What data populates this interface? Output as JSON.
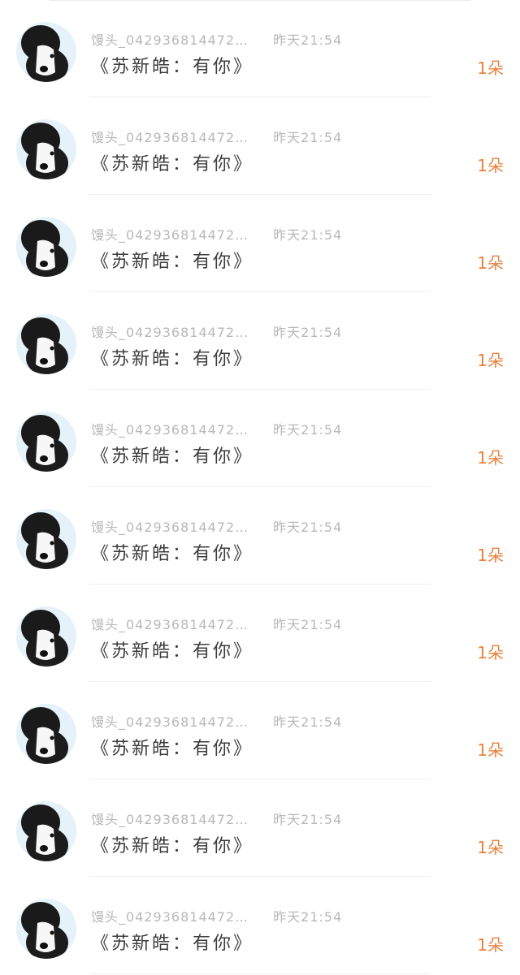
{
  "comments": [
    {
      "username": "馒头_042936814472…",
      "time": "昨天21:54",
      "title": "《苏新皓：有你》",
      "count": "1朵"
    },
    {
      "username": "馒头_042936814472…",
      "time": "昨天21:54",
      "title": "《苏新皓：有你》",
      "count": "1朵"
    },
    {
      "username": "馒头_042936814472…",
      "time": "昨天21:54",
      "title": "《苏新皓：有你》",
      "count": "1朵"
    },
    {
      "username": "馒头_042936814472…",
      "time": "昨天21:54",
      "title": "《苏新皓：有你》",
      "count": "1朵"
    },
    {
      "username": "馒头_042936814472…",
      "time": "昨天21:54",
      "title": "《苏新皓：有你》",
      "count": "1朵"
    },
    {
      "username": "馒头_042936814472…",
      "time": "昨天21:54",
      "title": "《苏新皓：有你》",
      "count": "1朵"
    },
    {
      "username": "馒头_042936814472…",
      "time": "昨天21:54",
      "title": "《苏新皓：有你》",
      "count": "1朵"
    },
    {
      "username": "馒头_042936814472…",
      "time": "昨天21:54",
      "title": "《苏新皓：有你》",
      "count": "1朵"
    },
    {
      "username": "馒头_042936814472…",
      "time": "昨天21:54",
      "title": "《苏新皓：有你》",
      "count": "1朵"
    },
    {
      "username": "馒头_042936814472…",
      "time": "昨天21:54",
      "title": "《苏新皓：有你》",
      "count": "1朵"
    }
  ],
  "colors": {
    "accent": "#e8823d",
    "meta_text": "#b8b8b8",
    "title_text": "#3d3d3d"
  },
  "icons": {
    "avatar": "puppy-avatar-icon"
  }
}
